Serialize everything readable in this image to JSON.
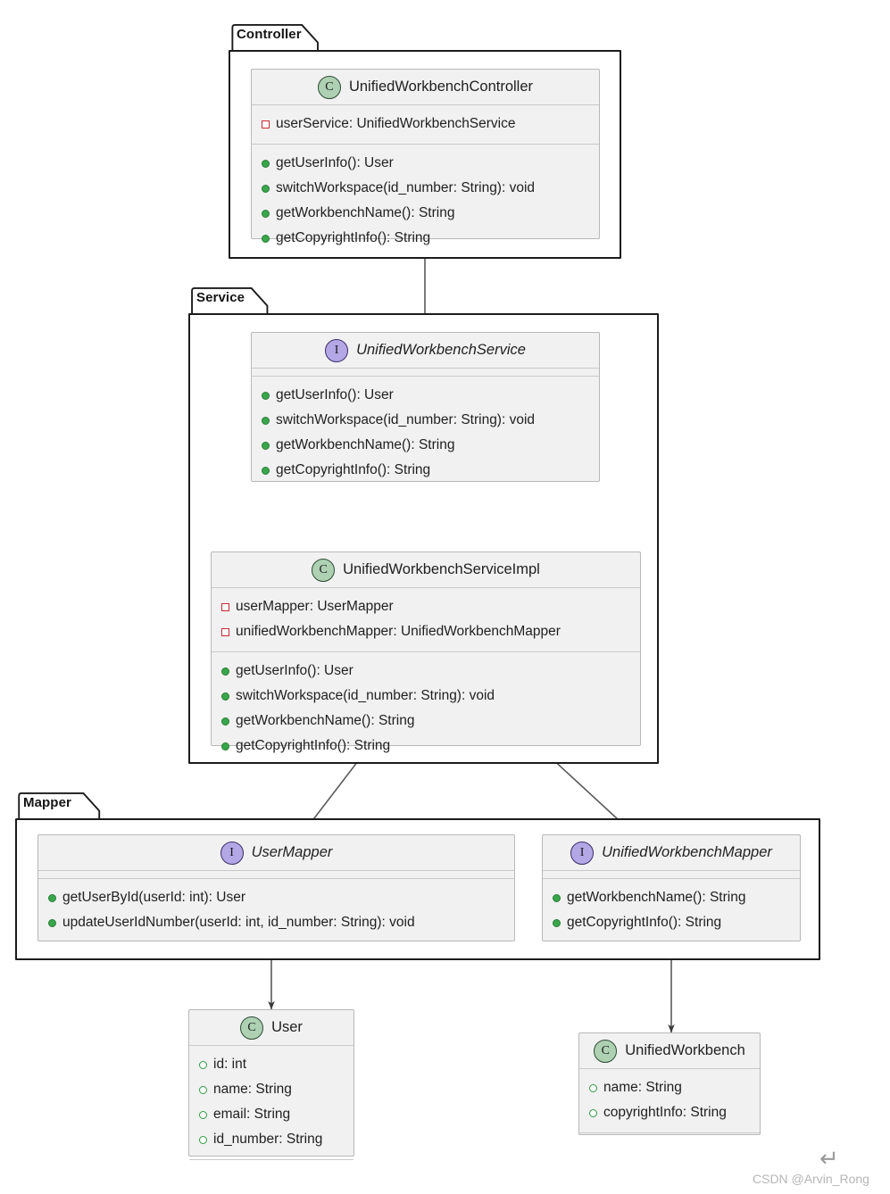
{
  "diagram": {
    "type": "uml-class-diagram",
    "background": "#ffffff",
    "colors": {
      "class_fill": "#f1f1f1",
      "class_border": "#b8b8b8",
      "package_border": "#1b1b1b",
      "class_icon_fill": "#add1b2",
      "interface_icon_fill": "#b4a7e5",
      "public_marker": "#38a64a",
      "private_marker": "#c82930",
      "watermark": "#b6b6b6"
    }
  },
  "packages": [
    {
      "name": "Controller",
      "label": "Controller"
    },
    {
      "name": "Service",
      "label": "Service"
    },
    {
      "name": "Mapper",
      "label": "Mapper"
    }
  ],
  "classes": {
    "controller": {
      "icon": "class-icon",
      "icon_letter": "C",
      "name": "UnifiedWorkbenchController",
      "italic": false,
      "fields": [
        {
          "marker": "priv-field",
          "text": "userService: UnifiedWorkbenchService"
        }
      ],
      "methods": [
        {
          "marker": "pub-method",
          "text": "getUserInfo(): User"
        },
        {
          "marker": "pub-method",
          "text": "switchWorkspace(id_number: String): void"
        },
        {
          "marker": "pub-method",
          "text": "getWorkbenchName(): String"
        },
        {
          "marker": "pub-method",
          "text": "getCopyrightInfo(): String"
        }
      ]
    },
    "service_interface": {
      "icon": "interface-icon",
      "icon_letter": "I",
      "name": "UnifiedWorkbenchService",
      "italic": true,
      "fields": [],
      "methods": [
        {
          "marker": "pub-method",
          "text": "getUserInfo(): User"
        },
        {
          "marker": "pub-method",
          "text": "switchWorkspace(id_number: String): void"
        },
        {
          "marker": "pub-method",
          "text": "getWorkbenchName(): String"
        },
        {
          "marker": "pub-method",
          "text": "getCopyrightInfo(): String"
        }
      ]
    },
    "service_impl": {
      "icon": "class-icon",
      "icon_letter": "C",
      "name": "UnifiedWorkbenchServiceImpl",
      "italic": false,
      "fields": [
        {
          "marker": "priv-field",
          "text": "userMapper: UserMapper"
        },
        {
          "marker": "priv-field",
          "text": "unifiedWorkbenchMapper: UnifiedWorkbenchMapper"
        }
      ],
      "methods": [
        {
          "marker": "pub-method",
          "text": "getUserInfo(): User"
        },
        {
          "marker": "pub-method",
          "text": "switchWorkspace(id_number: String): void"
        },
        {
          "marker": "pub-method",
          "text": "getWorkbenchName(): String"
        },
        {
          "marker": "pub-method",
          "text": "getCopyrightInfo(): String"
        }
      ]
    },
    "user_mapper": {
      "icon": "interface-icon",
      "icon_letter": "I",
      "name": "UserMapper",
      "italic": true,
      "fields": [],
      "methods": [
        {
          "marker": "pub-method",
          "text": "getUserById(userId: int): User"
        },
        {
          "marker": "pub-method",
          "text": "updateUserIdNumber(userId: int, id_number: String): void"
        }
      ]
    },
    "workbench_mapper": {
      "icon": "interface-icon",
      "icon_letter": "I",
      "name": "UnifiedWorkbenchMapper",
      "italic": true,
      "fields": [],
      "methods": [
        {
          "marker": "pub-method",
          "text": "getWorkbenchName(): String"
        },
        {
          "marker": "pub-method",
          "text": "getCopyrightInfo(): String"
        }
      ]
    },
    "user_entity": {
      "icon": "class-icon",
      "icon_letter": "C",
      "name": "User",
      "italic": false,
      "fields": [
        {
          "marker": "pub-field",
          "text": "id: int"
        },
        {
          "marker": "pub-field",
          "text": "name: String"
        },
        {
          "marker": "pub-field",
          "text": "email: String"
        },
        {
          "marker": "pub-field",
          "text": "id_number: String"
        }
      ],
      "methods": []
    },
    "workbench_entity": {
      "icon": "class-icon",
      "icon_letter": "C",
      "name": "UnifiedWorkbench",
      "italic": false,
      "fields": [
        {
          "marker": "pub-field",
          "text": "name: String"
        },
        {
          "marker": "pub-field",
          "text": "copyrightInfo: String"
        }
      ],
      "methods": []
    }
  },
  "relations": [
    {
      "name": "controller-to-service",
      "from": "UnifiedWorkbenchController",
      "to": "UnifiedWorkbenchService",
      "kind": "dependency-arrow"
    },
    {
      "name": "impl-realizes-service",
      "from": "UnifiedWorkbenchServiceImpl",
      "to": "UnifiedWorkbenchService",
      "kind": "realization"
    },
    {
      "name": "impl-to-user-mapper",
      "from": "UnifiedWorkbenchServiceImpl",
      "to": "UserMapper",
      "kind": "dependency-arrow"
    },
    {
      "name": "impl-to-workbench-mapper",
      "from": "UnifiedWorkbenchServiceImpl",
      "to": "UnifiedWorkbenchMapper",
      "kind": "dependency-arrow"
    },
    {
      "name": "user-mapper-to-user",
      "from": "UserMapper",
      "to": "User",
      "kind": "dependency-arrow"
    },
    {
      "name": "workbench-mapper-to-workbench",
      "from": "UnifiedWorkbenchMapper",
      "to": "UnifiedWorkbench",
      "kind": "dependency-arrow"
    }
  ],
  "watermark": {
    "glyph": "↵",
    "text": "CSDN @Arvin_Rong"
  }
}
